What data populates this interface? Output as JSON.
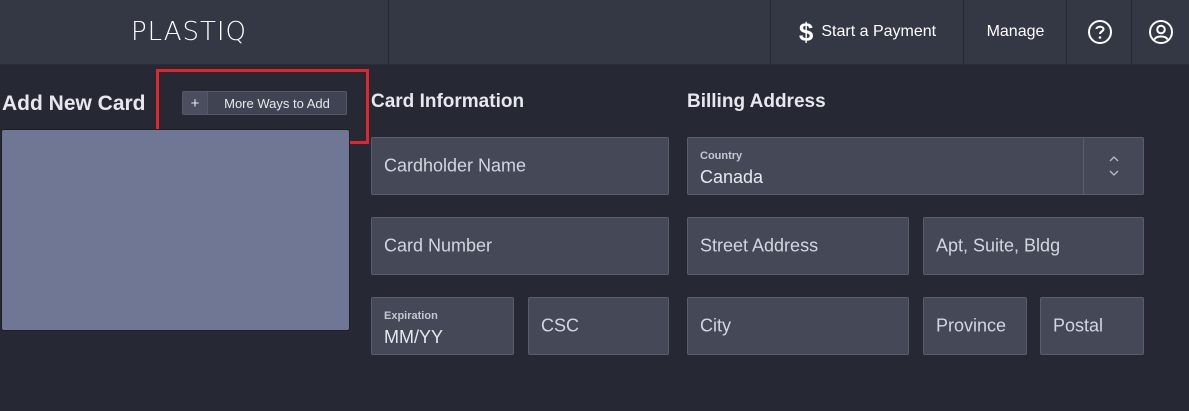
{
  "header": {
    "logo": "PLASTIQ",
    "nav": {
      "start_payment": "Start a Payment",
      "manage": "Manage"
    }
  },
  "add_card": {
    "title": "Add New Card",
    "more_ways_label": "More Ways to Add",
    "plus": "+"
  },
  "card_info": {
    "title": "Card Information",
    "cardholder_placeholder": "Cardholder Name",
    "card_number_placeholder": "Card Number",
    "expiration_label": "Expiration",
    "expiration_placeholder": "MM/YY",
    "csc_placeholder": "CSC"
  },
  "billing": {
    "title": "Billing Address",
    "country_label": "Country",
    "country_value": "Canada",
    "street_placeholder": "Street Address",
    "apt_placeholder": "Apt, Suite, Bldg",
    "city_placeholder": "City",
    "province_placeholder": "Province",
    "postal_placeholder": "Postal"
  },
  "colors": {
    "background": "#262834",
    "header": "#343744",
    "field": "#454857",
    "card_preview": "#6f7794",
    "highlight": "#e0252c"
  }
}
